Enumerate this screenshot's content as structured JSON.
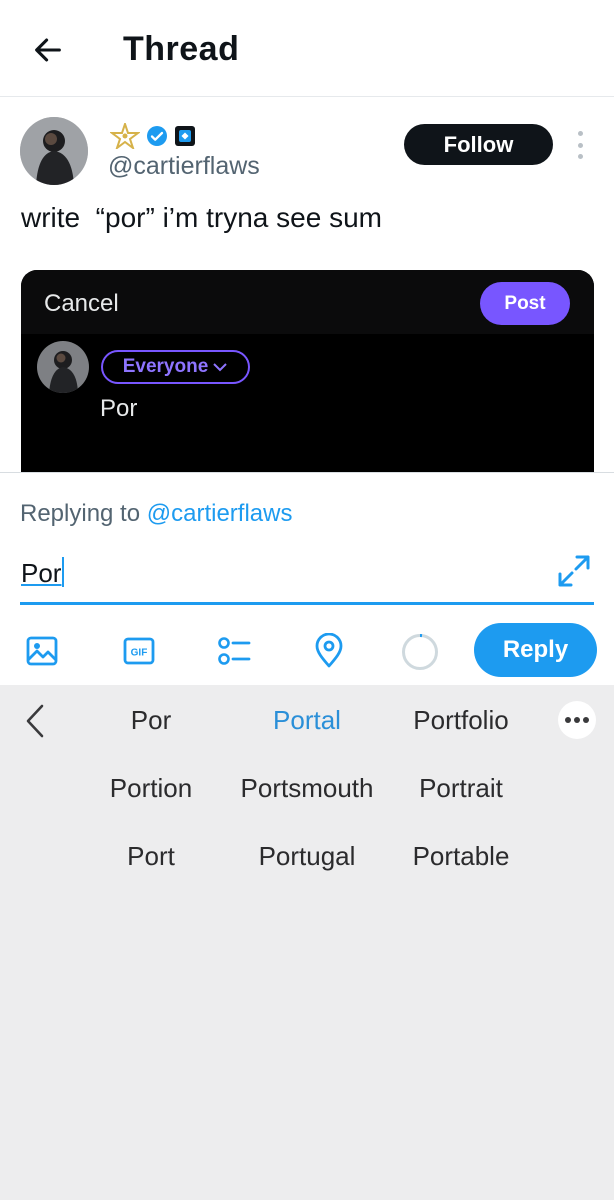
{
  "header": {
    "title": "Thread",
    "back_icon": "arrow-left-icon"
  },
  "post": {
    "handle": "@cartierflaws",
    "name_icons": [
      "star-icon",
      "verified-badge-icon",
      "affiliate-badge-icon"
    ],
    "follow_label": "Follow",
    "text": "write  “por” i’m tryna see sum",
    "embed": {
      "cancel_label": "Cancel",
      "post_label": "Post",
      "audience_label": "Everyone",
      "composer_text": "Por"
    }
  },
  "composer": {
    "replying_prefix": "Replying to",
    "replying_to": "@cartierflaws",
    "input_value": "Por",
    "reply_label": "Reply",
    "tools": [
      "image-icon",
      "gif-icon",
      "poll-icon",
      "location-icon"
    ]
  },
  "keyboard": {
    "suggestions": [
      [
        "Por",
        "Portal",
        "Portfolio"
      ],
      [
        "Portion",
        "Portsmouth",
        "Portrait"
      ],
      [
        "Port",
        "Portugal",
        "Portable"
      ]
    ],
    "highlighted": "Portal"
  },
  "colors": {
    "accent": "#1d9bf0",
    "embed_accent": "#7856ff",
    "keyboard_bg": "#ededee"
  }
}
